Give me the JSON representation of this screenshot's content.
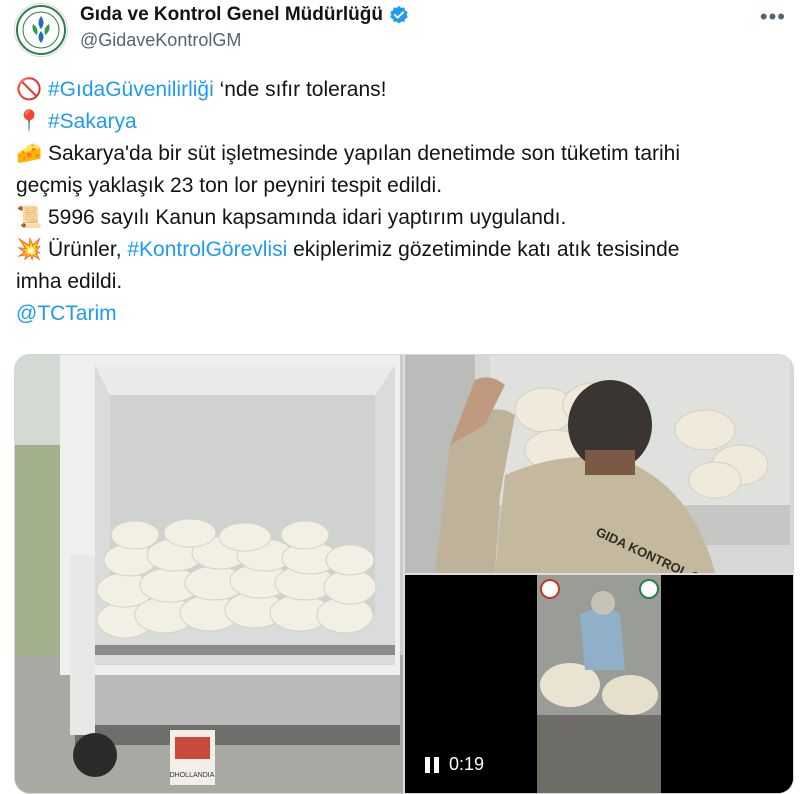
{
  "author": {
    "name": "Gıda ve Kontrol Genel Müdürlüğü",
    "handle": "@GidaveKontrolGM",
    "verified": true
  },
  "menu": {
    "more_label": "•••"
  },
  "text": {
    "l1_emoji": "🚫",
    "l1_tag": "#GıdaGüvenilirliği",
    "l1_rest": " ‘nde sıfır tolerans!",
    "l2_emoji": "📍",
    "l2_tag": "#Sakarya",
    "l3_emoji": "🧀",
    "l3": "Sakarya'da bir süt işletmesinde yapılan denetimde son tüketim tarihi",
    "l4": "geçmiş yaklaşık 23 ton lor peyniri tespit edildi.",
    "l5_emoji": "📜",
    "l5": "5996 sayılı Kanun kapsamında idari yaptırım uygulandı.",
    "l6_emoji": "💥",
    "l6_pre": "Ürünler, ",
    "l6_tag": "#KontrolGörevlisi",
    "l6_post": " ekiplerimiz gözetiminde katı atık tesisinde",
    "l7": "imha edildi.",
    "mention": "@TCTarim"
  },
  "media": {
    "jacket_text": "GIDA KONTROL GÖREVLİ",
    "box_text": "DHOLLANDIA",
    "video_time": "0:19"
  },
  "colors": {
    "link": "#1d9bf0",
    "verified": "#1d9bf0",
    "text": "#0f1419",
    "muted": "#536471"
  }
}
